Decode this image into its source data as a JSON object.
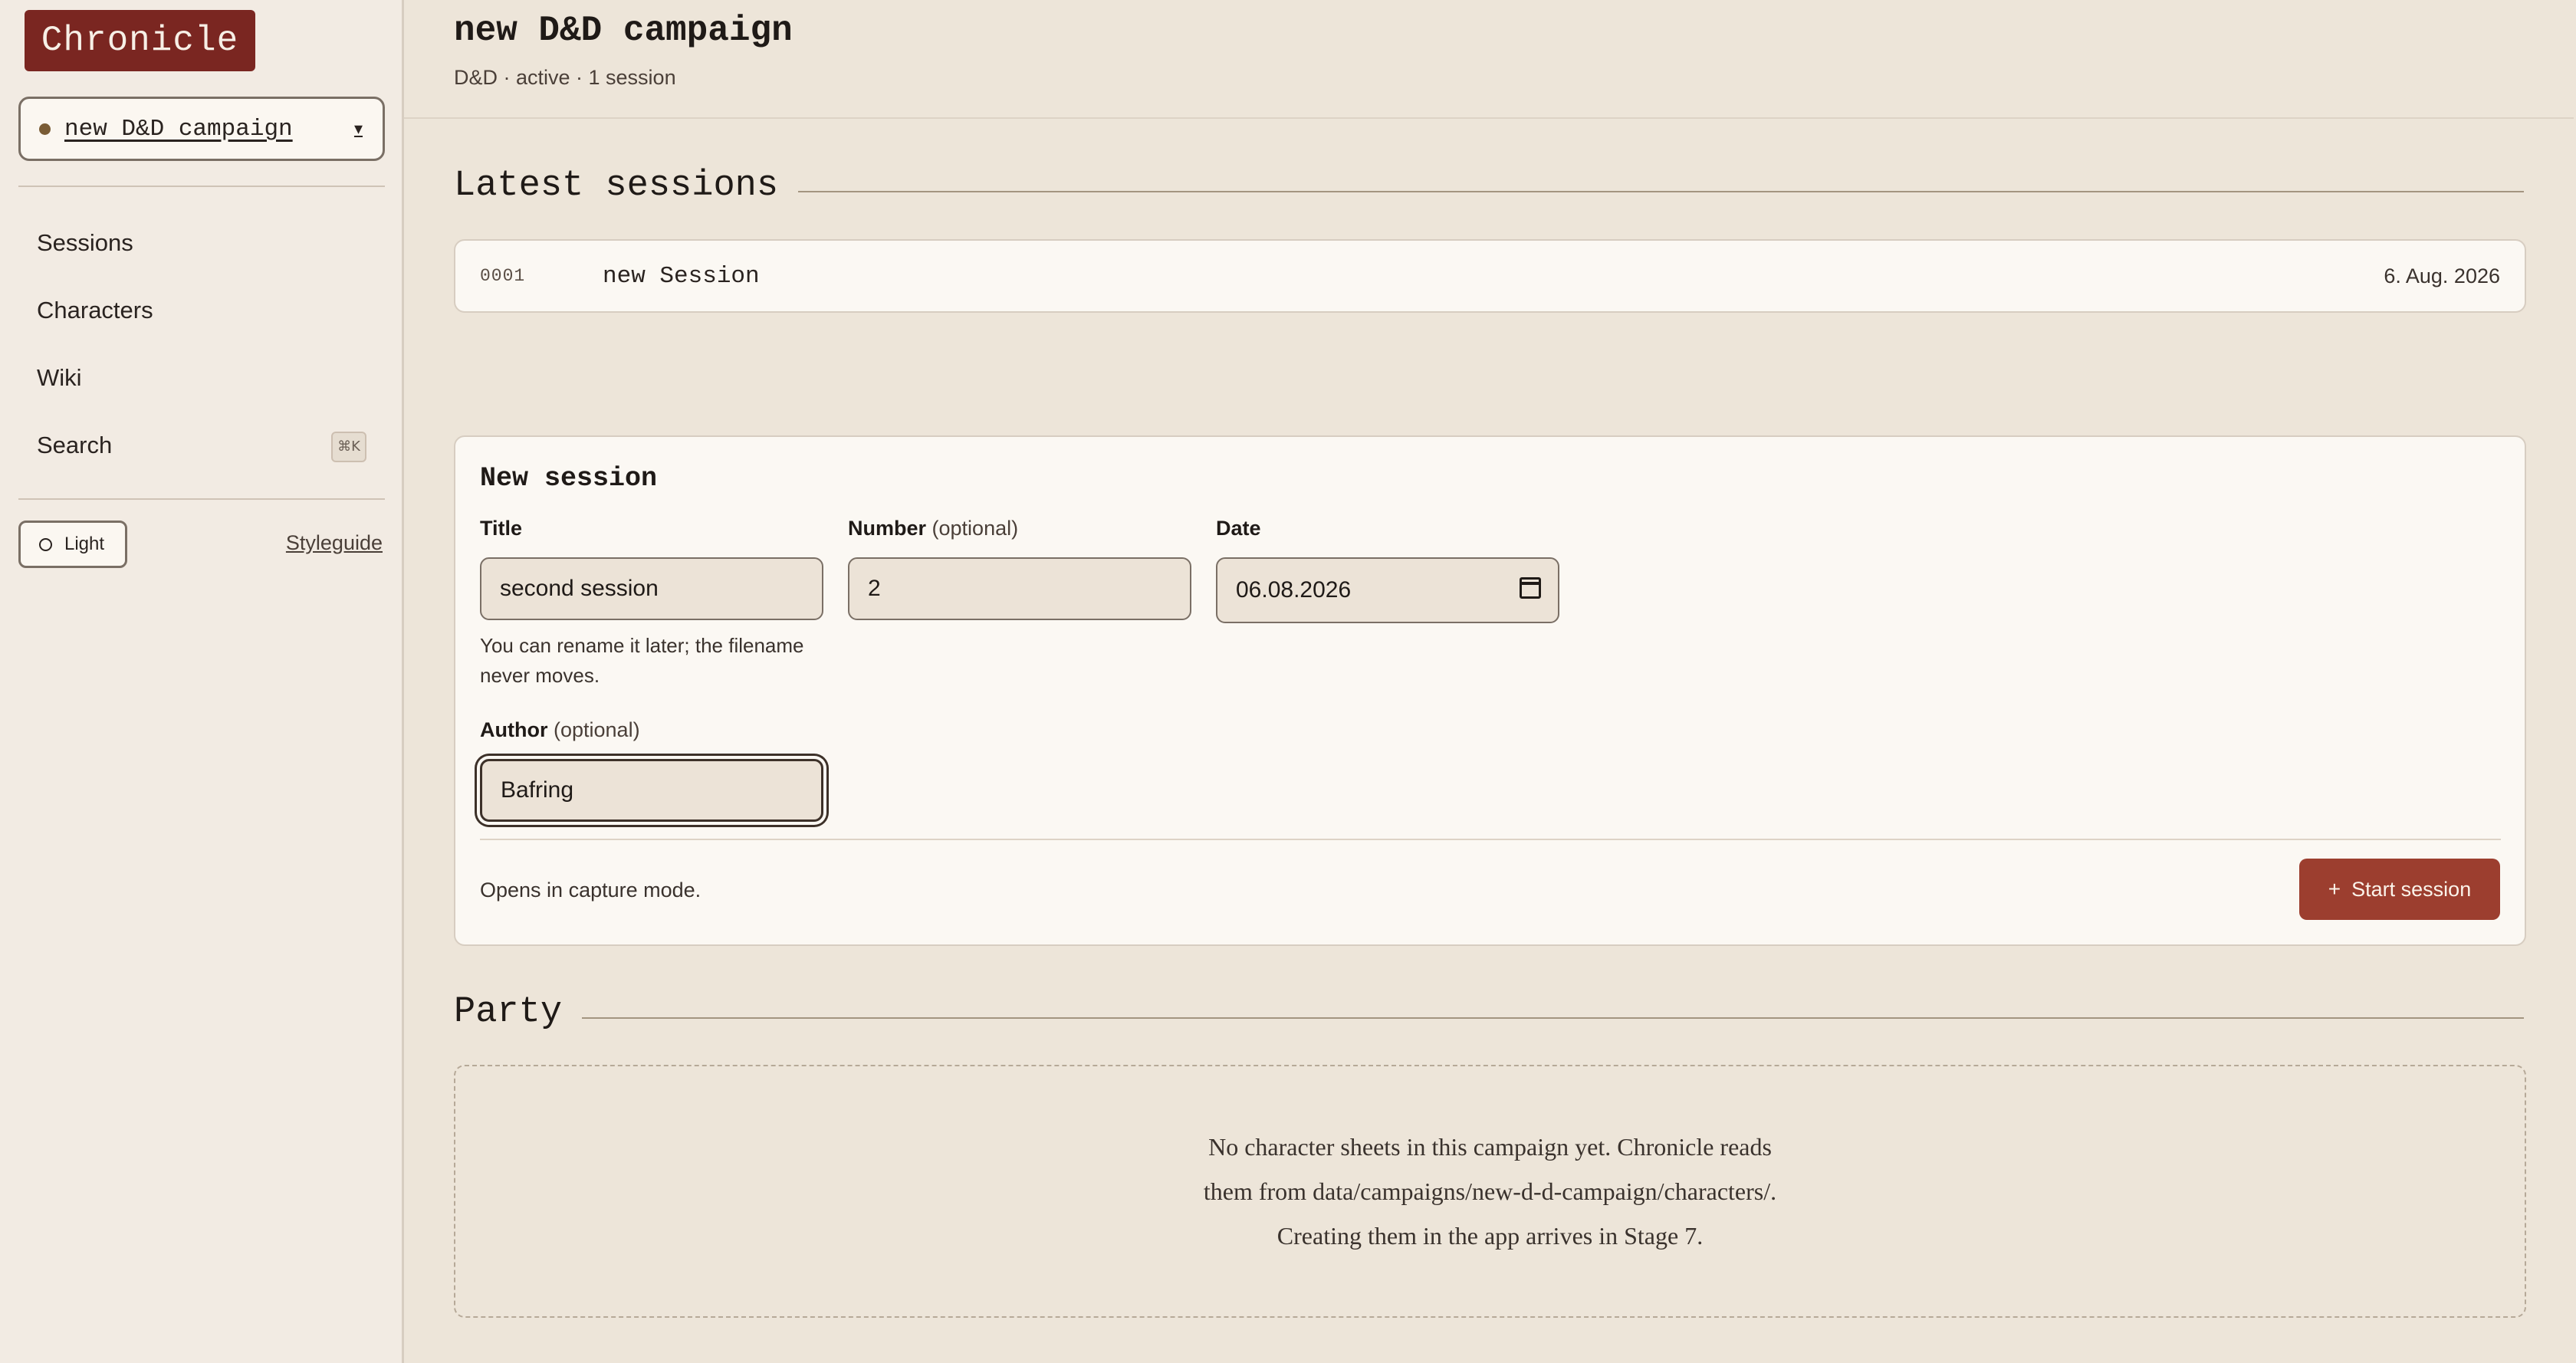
{
  "sidebar": {
    "logo": "Chronicle",
    "campaign_select": {
      "value": "new D&D campaign",
      "caret": "▾"
    },
    "nav": [
      {
        "label": "Sessions"
      },
      {
        "label": "Characters"
      },
      {
        "label": "Wiki"
      },
      {
        "label": "Search",
        "shortcut": "⌘K"
      }
    ],
    "theme_toggle": "Light",
    "styleguide_link": "Styleguide"
  },
  "header": {
    "title": "new D&D campaign",
    "subtitle": "D&D · active · 1 session"
  },
  "latest_sessions": {
    "heading": "Latest sessions",
    "rows": [
      {
        "number": "0001",
        "title": "new Session",
        "date": "6. Aug. 2026"
      }
    ]
  },
  "new_session": {
    "heading": "New session",
    "title_field": {
      "label": "Title",
      "value": "second session",
      "help": "You can rename it later; the filename never moves."
    },
    "number_field": {
      "label": "Number",
      "optional": "(optional)",
      "value": "2"
    },
    "date_field": {
      "label": "Date",
      "value": "06.08.2026"
    },
    "author_field": {
      "label": "Author",
      "optional": "(optional)",
      "value": "Bafring"
    },
    "footer_text": "Opens in capture mode.",
    "submit": {
      "icon": "+",
      "label": "Start session"
    }
  },
  "party": {
    "heading": "Party",
    "empty_text": "No character sheets in this campaign yet. Chronicle reads them from data/campaigns/new-d-d-campaign/characters/. Creating them in the app arrives in Stage 7."
  },
  "colors": {
    "accent": "#7a2621",
    "button": "#9c3e2f",
    "background": "#ede5d9",
    "sidebar": "#f2ebe3",
    "card": "#fbf8f3"
  }
}
